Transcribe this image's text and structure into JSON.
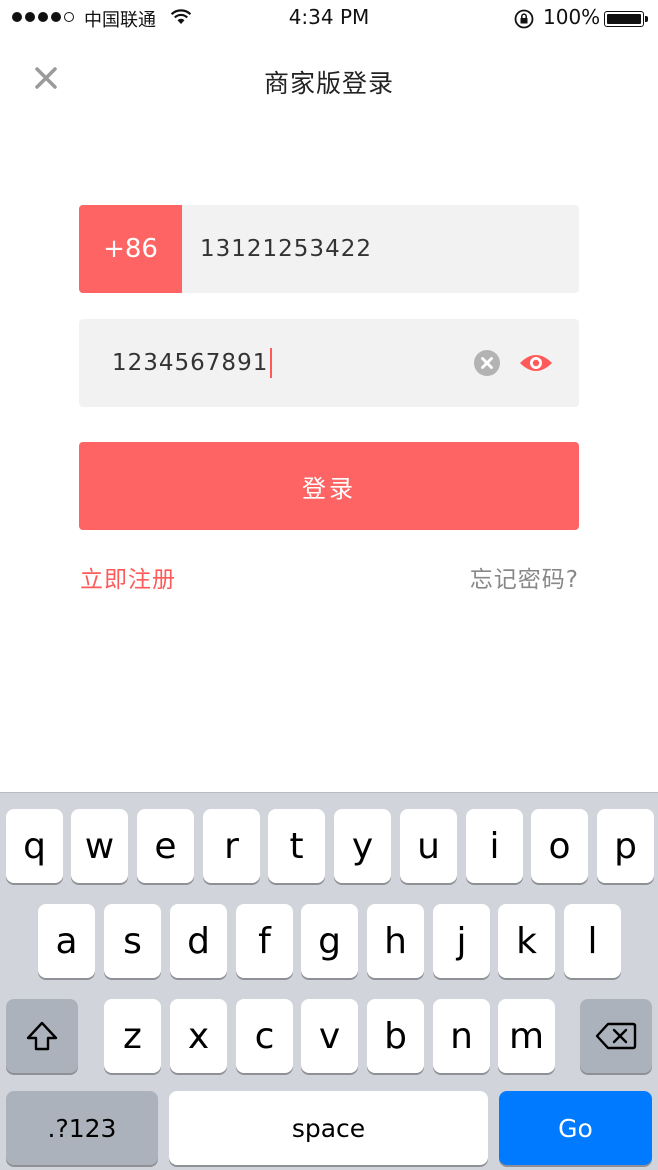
{
  "status_bar": {
    "carrier": "中国联通",
    "time": "4:34 PM",
    "battery": "100%"
  },
  "nav": {
    "title": "商家版登录",
    "close_icon": "close-icon"
  },
  "form": {
    "country_code": "+86",
    "phone": "13121253422",
    "password": "1234567891",
    "login_label": "登录",
    "register_label": "立即注册",
    "forgot_label": "忘记密码?"
  },
  "keyboard": {
    "row1": [
      "q",
      "w",
      "e",
      "r",
      "t",
      "y",
      "u",
      "i",
      "o",
      "p"
    ],
    "row2": [
      "a",
      "s",
      "d",
      "f",
      "g",
      "h",
      "j",
      "k",
      "l"
    ],
    "row3": [
      "z",
      "x",
      "c",
      "v",
      "b",
      "n",
      "m"
    ],
    "num_label": ".?123",
    "space_label": "space",
    "go_label": "Go"
  },
  "colors": {
    "accent": "#ff6464",
    "go": "#007aff"
  }
}
